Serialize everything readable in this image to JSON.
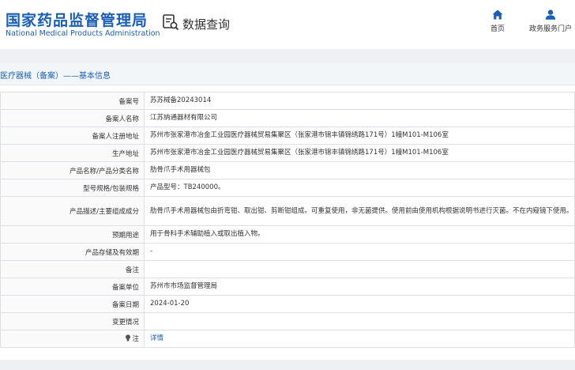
{
  "header": {
    "logo_cn": "国家药品监督管理局",
    "logo_en": "National Medical Products Administration",
    "query_title": "数据查询",
    "nav": [
      {
        "label": "首页",
        "icon": "home-icon"
      },
      {
        "label": "政务服务门户",
        "icon": "user-icon"
      }
    ]
  },
  "section": {
    "title": "医疗器械（备案）——基本信息"
  },
  "rows": [
    {
      "label": "备案号",
      "value": "苏苏械备20243014"
    },
    {
      "label": "备案人名称",
      "value": "江苏纳通器材有限公司"
    },
    {
      "label": "备案人注册地址",
      "value": "苏州市张家港市冶金工业园医疗器械贸易集聚区（张家港市锦丰镇锦绣路171号）1幢M101-M106室"
    },
    {
      "label": "生产地址",
      "value": "苏州市张家港市冶金工业园医疗器械贸易集聚区（张家港市锦丰镇锦绣路171号）1幢M101-M106室"
    },
    {
      "label": "产品名称/产品分类名称",
      "value": "肋骨爪手术用器械包"
    },
    {
      "label": "型号规格/包装规格",
      "value": "产品型号：TB240000。"
    },
    {
      "label": "产品描述/主要组成成分",
      "value": "肋骨爪手术用器械包由折弯钳、取出钳、剪断钳组成。可重复使用，非无菌提供。使用前由使用机构根据说明书进行灭菌。不在内窥镜下使用。"
    },
    {
      "label": "预期用途",
      "value": "用于骨科手术辅助植入或取出植入物。"
    },
    {
      "label": "产品存储及有效期",
      "value": "-"
    },
    {
      "label": "备注",
      "value": ""
    },
    {
      "label": "备案单位",
      "value": "苏州市市场监督管理局"
    },
    {
      "label": "备案日期",
      "value": "2024-01-20"
    },
    {
      "label": "变更情况",
      "value": ""
    },
    {
      "label": "注",
      "value": "详情",
      "icon": "tip-icon"
    }
  ],
  "colors": {
    "brand_blue": "#1a5fb4",
    "link_blue": "#1a5fb4"
  }
}
